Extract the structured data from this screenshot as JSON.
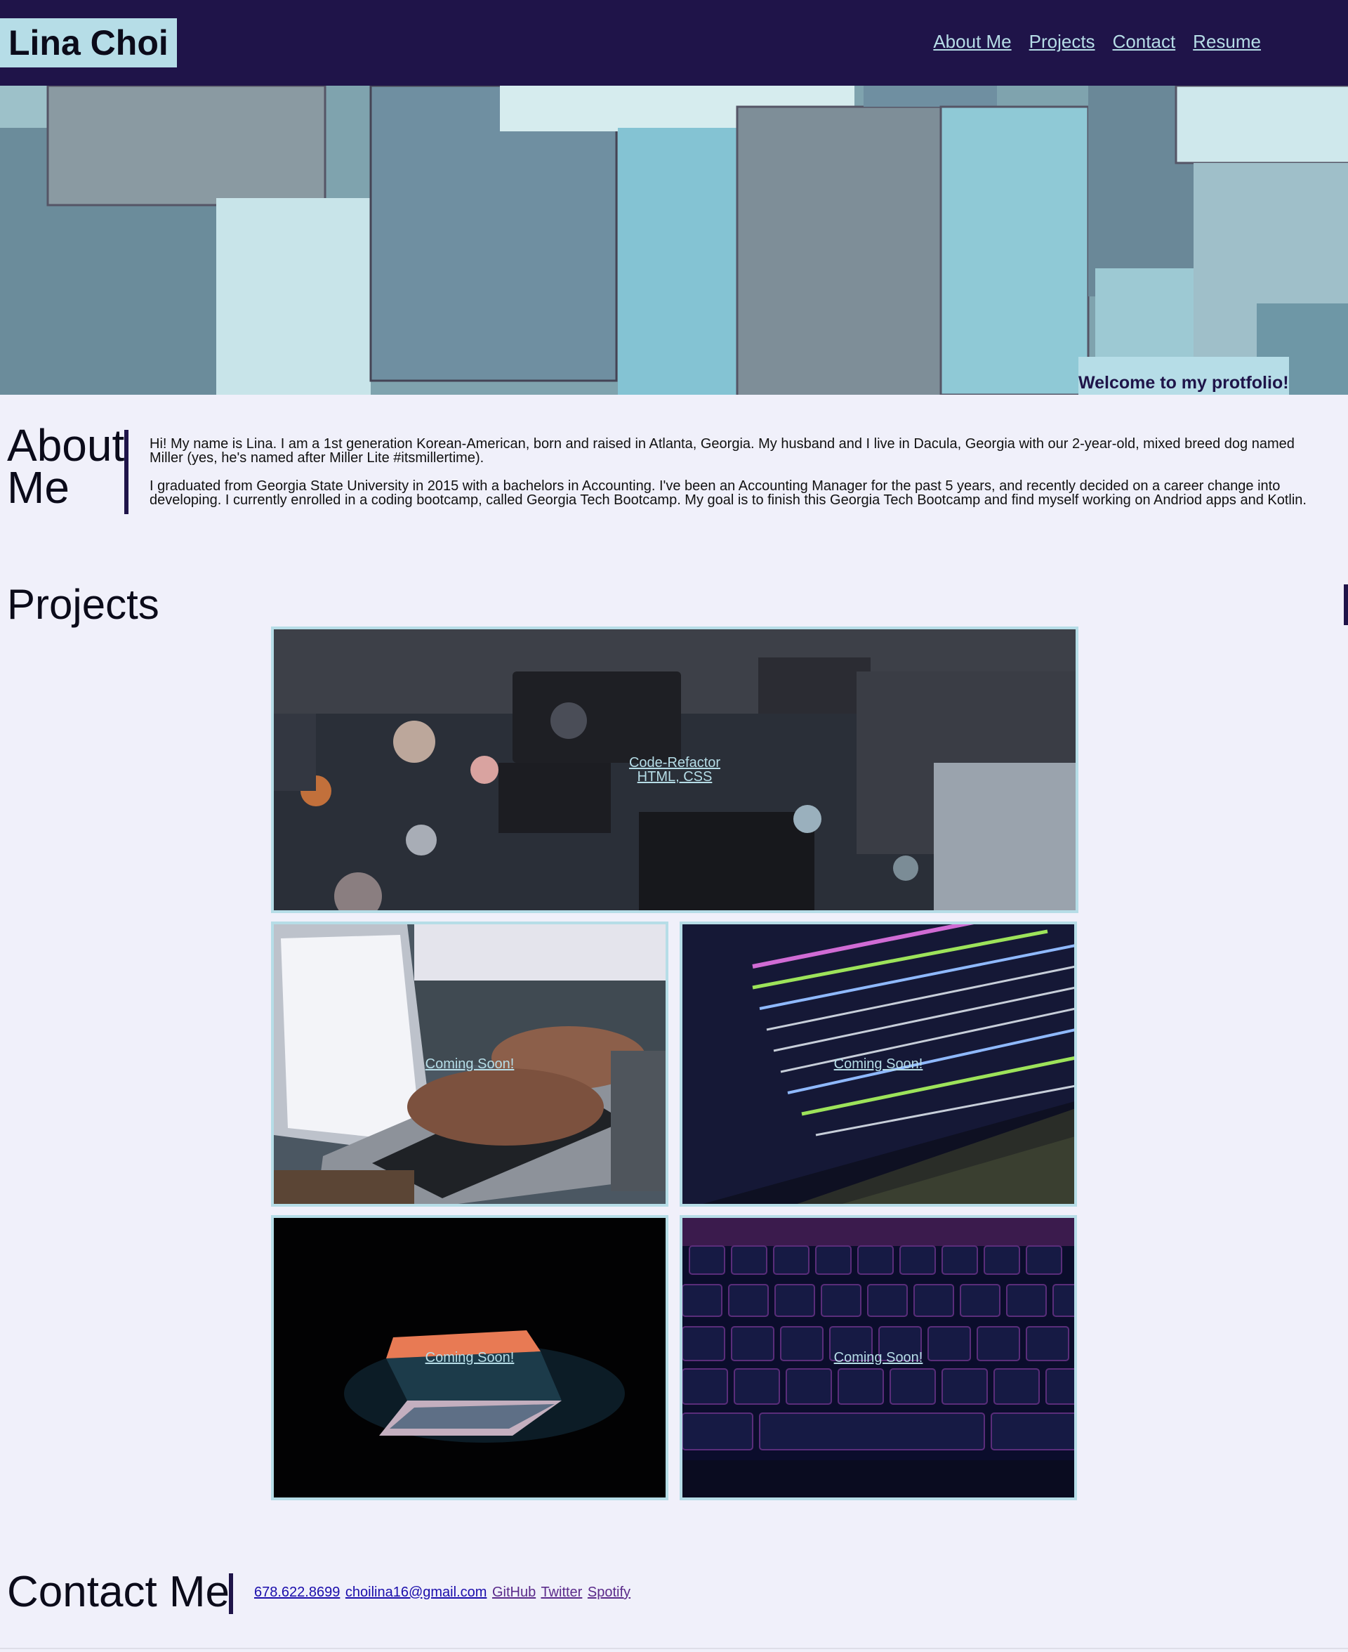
{
  "header": {
    "brand": "Lina Choi",
    "nav": [
      "About Me",
      "Projects",
      "Contact",
      "Resume"
    ]
  },
  "hero": {
    "welcome": "Welcome to my protfolio!"
  },
  "about": {
    "title": "About Me",
    "paragraphs": [
      "Hi! My name is Lina. I am a 1st generation Korean-American, born and raised in Atlanta, Georgia. My husband and I live in Dacula, Georgia with our 2-year-old, mixed breed dog named Miller (yes, he's named after Miller Lite #itsmillertime).",
      "I graduated from Georgia State University in 2015 with a bachelors in Accounting. I've been an Accounting Manager for the past 5 years, and recently decided on a career change into developing. I currently enrolled in a coding bootcamp, called Georgia Tech Bootcamp. My goal is to finish this Georgia Tech Bootcamp and find myself working on Andriod apps and Kotlin."
    ]
  },
  "projects": {
    "title": "Projects",
    "featured": {
      "name": "Code-Refactor",
      "tech": "HTML, CSS"
    },
    "items": [
      {
        "label": "Coming Soon!"
      },
      {
        "label": "Coming Soon!"
      },
      {
        "label": "Coming Soon!"
      },
      {
        "label": "Coming Soon!"
      }
    ]
  },
  "contact": {
    "title": "Contact Me",
    "links": [
      "678.622.8699",
      "choilina16@gmail.com",
      "GitHub",
      "Twitter",
      "Spotify"
    ]
  },
  "colors": {
    "header_bg": "#1f1449",
    "accent": "#b6dde7",
    "page_bg": "#f0f0fa"
  }
}
